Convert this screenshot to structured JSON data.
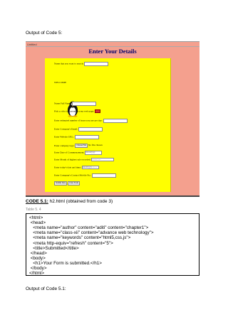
{
  "heading_top": "Output of Code 5:",
  "screenshot": {
    "tab_text": "Untitled",
    "title": "Enter Your Details",
    "rows": [
      {
        "label": "Name that you want to search:",
        "control": "text"
      },
      {
        "label": "WELCOME",
        "control": "none"
      },
      {
        "label": "Name Full Name:",
        "control": "text"
      },
      {
        "label": "Pick a color to customize your web page:",
        "control": "color"
      },
      {
        "label": "Enter estimated number of hours you use per day:",
        "control": "text"
      },
      {
        "label": "Enter Company's Email:",
        "control": "text"
      },
      {
        "label": "Enter Website URL:",
        "control": "text"
      },
      {
        "label": "Enter company logo:",
        "control": "file",
        "button": "Choose File",
        "after": "No file chosen"
      },
      {
        "label": "Enter Date of Commencement:",
        "control": "date",
        "value": "mm/dd/yyyy"
      },
      {
        "label": "Enter Month of highest sale recorded:",
        "control": "month",
        "value": "--------- ----"
      },
      {
        "label": "Enter today's date and time:",
        "control": "date",
        "value": "mm/dd/yyyy --:-- --"
      },
      {
        "label": "Enter Company's Contact Mobile No.:",
        "control": "text"
      }
    ],
    "submit_label": "Submit Data",
    "clear_label": "Clear Form"
  },
  "caption_bold": "CODE 5.1:",
  "caption_rest": " h2.html (obtained from code 3)",
  "table_label": "Table 5. 4",
  "code_lines": [
    "<html>",
    " <head>",
    "   <meta name=\"author\" content=\"aditi\" content=\"chapter1\">",
    "   <meta name=\"class-xii\" content=\"advance web technology\">",
    "   <meta name=\"keywords\" content=\"html5,css,js\">",
    "   <meta http-equiv=\"refresh\" content=\"5\">",
    "   <title>Submitted</title>",
    " </head>",
    " <body>",
    "   <h1>Your Form is submitted.</h1>",
    " </body>",
    "</html>"
  ],
  "heading_bottom": "Output of Code 5.1:"
}
